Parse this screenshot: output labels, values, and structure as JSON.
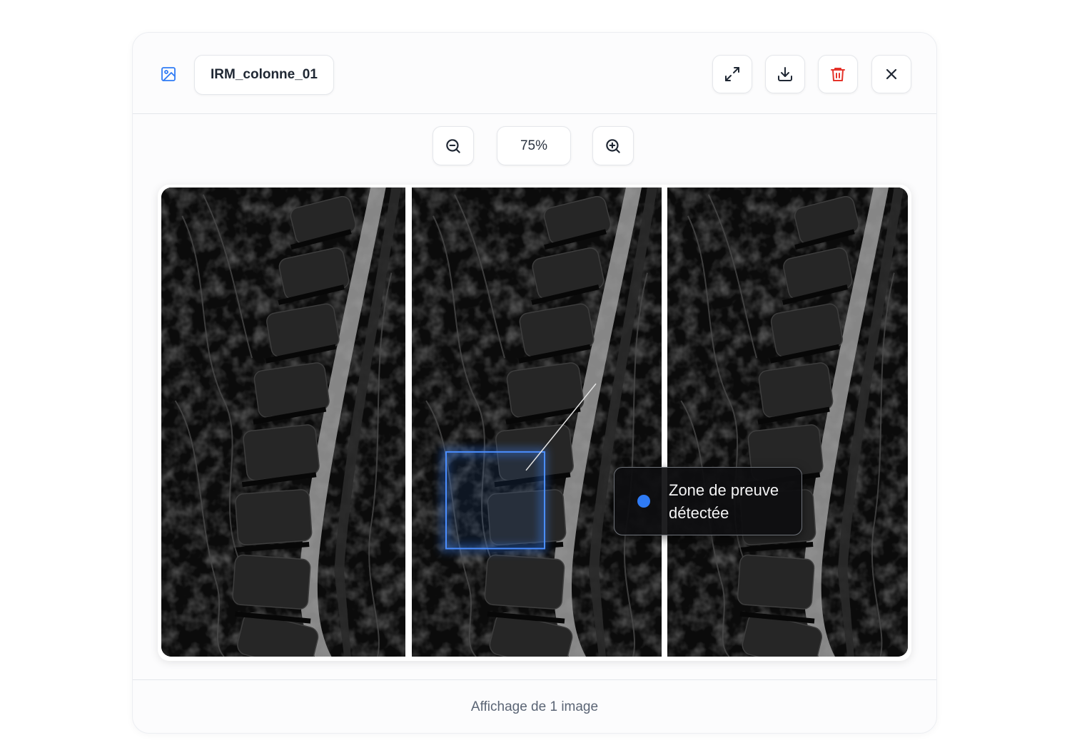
{
  "header": {
    "file_name": "IRM_colonne_01",
    "icons": {
      "file": "image-icon",
      "expand": "expand-icon",
      "download": "download-icon",
      "delete": "trash-icon",
      "close": "close-icon"
    }
  },
  "zoom": {
    "level": "75%",
    "zoom_out_icon": "zoom-out-icon",
    "zoom_in_icon": "zoom-in-icon"
  },
  "annotation": {
    "label": "Zone de preuve détectée"
  },
  "footer": {
    "status": "Affichage de 1 image"
  },
  "colors": {
    "accent": "#2f7bf5",
    "danger": "#e5332a",
    "text": "#1f2733",
    "muted": "#5b6575"
  }
}
